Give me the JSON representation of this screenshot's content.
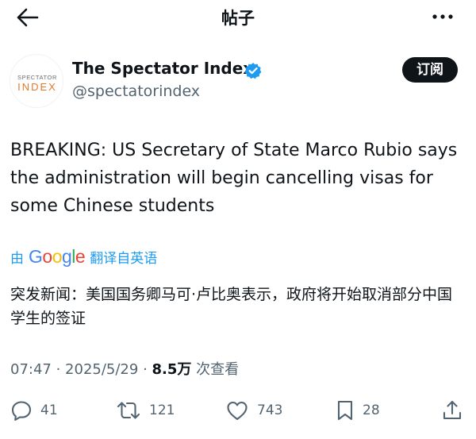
{
  "header": {
    "title": "帖子",
    "back_icon": "arrow-left-icon",
    "more_icon": "more-horizontal-icon"
  },
  "author": {
    "avatar_text_line1": "SPECTATOR",
    "avatar_text_line2": "INDEX",
    "display_name": "The Spectator Index",
    "handle": "@spectatorindex",
    "verified_icon": "verified-badge-icon",
    "verified_color": "#1d9bf0"
  },
  "subscribe_label": "订阅",
  "post": {
    "text": "BREAKING: US Secretary of State Marco Rubio says the administration will begin cancelling visas for some Chinese students"
  },
  "translation": {
    "prefix": "由",
    "provider": "Google",
    "suffix": "翻译自英语",
    "text": "突发新闻：美国国务卿马可·卢比奥表示，政府将开始取消部分中国学生的签证"
  },
  "meta": {
    "time": "07:47",
    "separator1": " · ",
    "date": "2025/5/29",
    "separator2": " · ",
    "views": "8.5万",
    "views_suffix": " 次查看"
  },
  "actions": {
    "reply": {
      "icon": "reply-icon",
      "count": "41"
    },
    "repost": {
      "icon": "repost-icon",
      "count": "121"
    },
    "like": {
      "icon": "heart-icon",
      "count": "743"
    },
    "bookmark": {
      "icon": "bookmark-icon",
      "count": "28"
    },
    "share": {
      "icon": "share-icon"
    }
  },
  "colors": {
    "text": "#0f1419",
    "secondary": "#536471",
    "accent": "#1d9bf0",
    "avatar_orange": "#e07a2f",
    "google_blue": "#4285f4",
    "google_red": "#ea4335",
    "google_yellow": "#fbbc05",
    "google_green": "#34a853"
  }
}
